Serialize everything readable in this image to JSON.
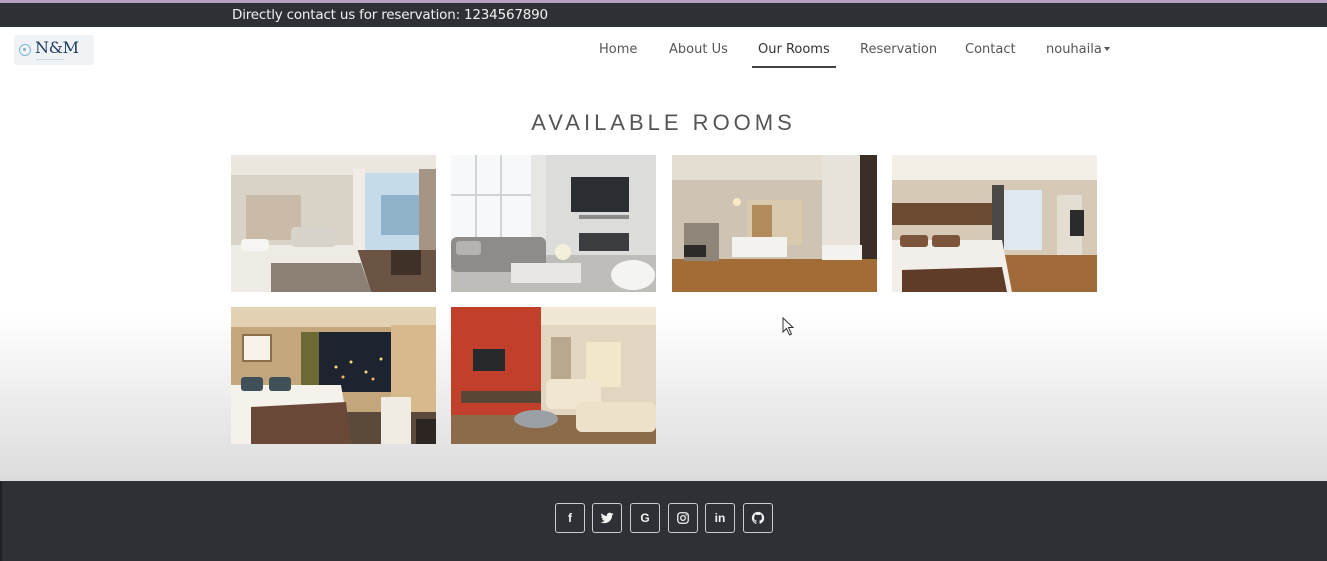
{
  "topbar": {
    "contact_text": "Directly contact us for reservation: 1234567890"
  },
  "navbar": {
    "logo": {
      "brand": "N&M",
      "icon": "logo-ring-icon"
    },
    "links": [
      {
        "label": "Home",
        "active": false
      },
      {
        "label": "About Us",
        "active": false
      },
      {
        "label": "Our Rooms",
        "active": true
      },
      {
        "label": "Reservation",
        "active": false
      },
      {
        "label": "Contact",
        "active": false
      }
    ],
    "user_menu": {
      "label": "nouhaila",
      "icon": "caret-down-icon"
    }
  },
  "main": {
    "title": "AVAILABLE ROOMS",
    "rooms": [
      {
        "name": "room-photo-1"
      },
      {
        "name": "room-photo-2"
      },
      {
        "name": "room-photo-3"
      },
      {
        "name": "room-photo-4"
      },
      {
        "name": "room-photo-5"
      },
      {
        "name": "room-photo-6"
      }
    ]
  },
  "footer": {
    "social_icons": [
      "facebook-icon",
      "twitter-icon",
      "google-icon",
      "instagram-icon",
      "linkedin-icon",
      "github-icon"
    ],
    "social_glyphs": {
      "facebook": "f",
      "google": "G",
      "linkedin": "in"
    }
  },
  "colors": {
    "dark_bar": "#2d3135",
    "top_accent": "#b99fc4",
    "text": "#555555"
  }
}
